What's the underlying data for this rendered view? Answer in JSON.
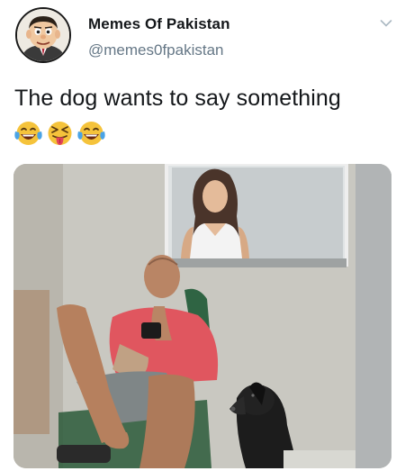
{
  "tweet": {
    "display_name": "Memes Of Pakistan",
    "handle": "@memes0fpakistan",
    "text": "The dog wants to say something",
    "emojis": [
      "face-with-tears-of-joy",
      "squinting-face-with-tongue",
      "face-with-tears-of-joy"
    ]
  },
  "colors": {
    "text_primary": "#14171a",
    "text_secondary": "#657786",
    "emoji_yellow": "#f5c33b",
    "shirt": "#e0565f"
  },
  "icons": {
    "avatar": "cartoon-man-avatar",
    "menu": "chevron-down-icon"
  }
}
